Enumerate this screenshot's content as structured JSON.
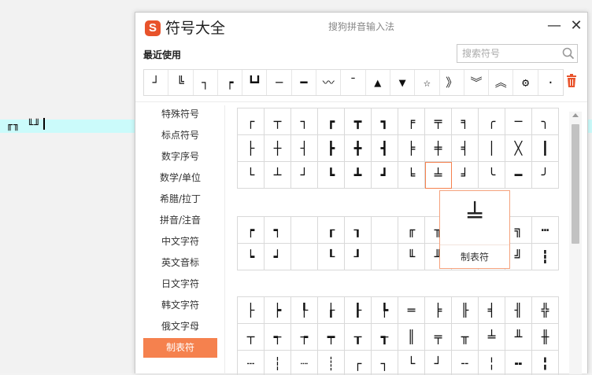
{
  "document": {
    "text": "╓╖ ╙╜"
  },
  "window": {
    "logo_letter": "S",
    "title": "符号大全",
    "ime_name": "搜狗拼音输入法",
    "minimize": "—",
    "close": "✕"
  },
  "recent": {
    "label": "最近使用",
    "search_placeholder": "搜索符号",
    "symbols": [
      "┘",
      "╚",
      "┐",
      "┍",
      "┗┛",
      "─",
      "━",
      "〰",
      "¯",
      "▲",
      "▼",
      "☆",
      "》",
      "︾",
      "︽",
      "⚙",
      "·"
    ]
  },
  "sidebar": {
    "items": [
      "特殊符号",
      "标点符号",
      "数字序号",
      "数学/单位",
      "希腊/拉丁",
      "拼音/注音",
      "中文字符",
      "英文音标",
      "日文字符",
      "韩文字符",
      "俄文字母",
      "制表符"
    ],
    "active_index": 11
  },
  "groups": [
    {
      "rows": [
        [
          "┌",
          "┬",
          "┐",
          "┏",
          "┳",
          "┓",
          "╒",
          "╤",
          "╕",
          "╭",
          "─",
          "╮"
        ],
        [
          "├",
          "┼",
          "┤",
          "┣",
          "╋",
          "┫",
          "╞",
          "╪",
          "╡",
          "│",
          "╳",
          "┃"
        ],
        [
          "└",
          "┴",
          "┘",
          "┗",
          "┻",
          "┛",
          "╘",
          "╧",
          "╛",
          "╰",
          "━",
          "╯"
        ]
      ]
    },
    {
      "rows": [
        [
          "┍",
          "┑",
          "",
          "┎",
          "┒",
          "",
          "╓",
          "╖",
          "",
          "╔",
          "╗",
          "┅",
          "┉"
        ],
        [
          "┕",
          "┙",
          "",
          "┖",
          "┚",
          "",
          "╙",
          "╜",
          "",
          "╚",
          "╝",
          "┇",
          "┋"
        ]
      ]
    },
    {
      "rows": [
        [
          "├",
          "┝",
          "┞",
          "┟",
          "┠",
          "┡",
          "═",
          "╞",
          "╟",
          "╡",
          "╢",
          "╬"
        ],
        [
          "┬",
          "┭",
          "┮",
          "┯",
          "┰",
          "┱",
          "║",
          "╤",
          "╥",
          "╧",
          "╨",
          "╫"
        ],
        [
          "┄",
          "┆",
          "┈",
          "┊",
          "┌",
          "┐",
          "└",
          "┘",
          "╌",
          "╎",
          "╍",
          "╏"
        ]
      ]
    }
  ],
  "preview": {
    "glyph": "╧",
    "label": "制表符"
  },
  "colors": {
    "accent": "#f5814e",
    "logo": "#e8532b",
    "doc_highlight": "#cbfbfb"
  }
}
